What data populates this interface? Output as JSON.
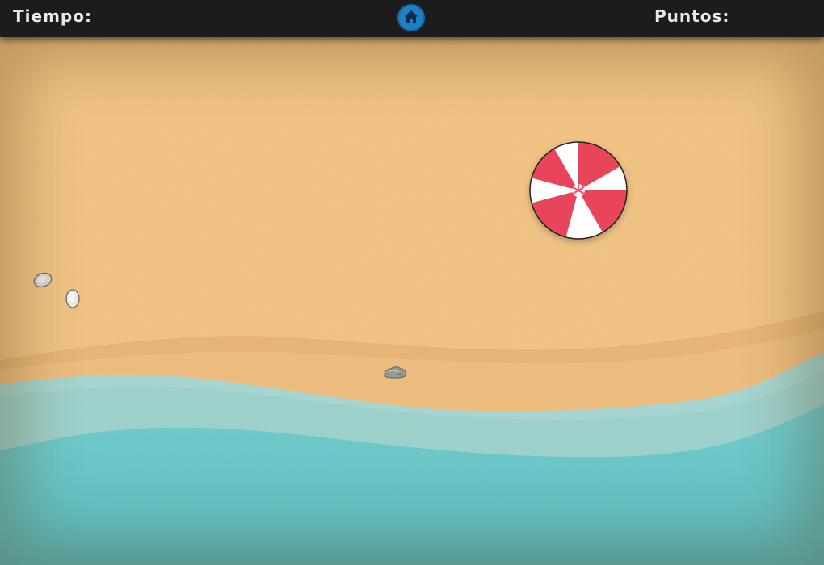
{
  "hud": {
    "time_label": "Tiempo:",
    "score_label": "Puntos:",
    "home_icon": "home-icon"
  },
  "colors": {
    "topbar": "#1c1c1c",
    "hud_text": "#f1e6ef",
    "home_button": "#1f7fc4",
    "sand": "#f2c585",
    "wet_sand": "#eab978",
    "foam": "#a9d8d3",
    "water": "#6ccbcb",
    "ball_red": "#e8455b",
    "ball_white": "#ffffff"
  },
  "scene": {
    "objects": [
      "beach-ball",
      "shell",
      "shell",
      "rock"
    ]
  }
}
